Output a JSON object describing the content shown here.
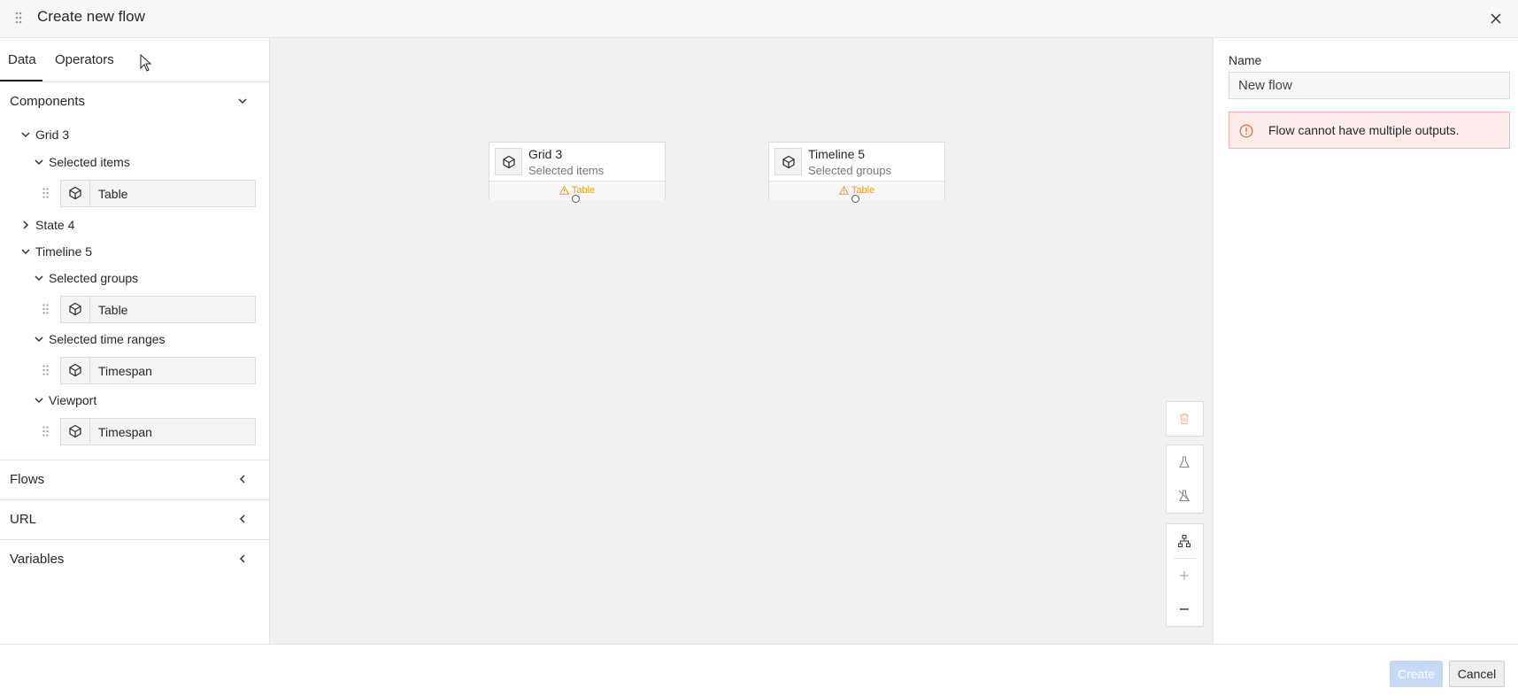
{
  "window": {
    "title": "Create new flow"
  },
  "tabs": [
    {
      "label": "Data",
      "active": true
    },
    {
      "label": "Operators",
      "active": false
    }
  ],
  "components": {
    "label": "Components",
    "tree": {
      "grid3": {
        "label": "Grid 3",
        "selected_items": {
          "label": "Selected items",
          "leaf": "Table"
        }
      },
      "state4": {
        "label": "State 4"
      },
      "timeline5": {
        "label": "Timeline 5",
        "selected_groups": {
          "label": "Selected groups",
          "leaf": "Table"
        },
        "selected_time_ranges": {
          "label": "Selected time ranges",
          "leaf": "Timespan"
        },
        "viewport": {
          "label": "Viewport",
          "leaf": "Timespan"
        }
      }
    }
  },
  "sections": {
    "flows": "Flows",
    "url": "URL",
    "variables": "Variables"
  },
  "canvas": {
    "nodes": [
      {
        "title": "Grid 3",
        "subtitle": "Selected items",
        "port": "Table"
      },
      {
        "title": "Timeline 5",
        "subtitle": "Selected groups",
        "port": "Table"
      }
    ]
  },
  "properties": {
    "name_label": "Name",
    "name_value": "New flow",
    "error": "Flow cannot have multiple outputs."
  },
  "footer": {
    "create": "Create",
    "cancel": "Cancel"
  },
  "colors": {
    "warning": "#e8a317",
    "error_bg": "#fdecec",
    "error_icon": "#e8734a",
    "primary_disabled": "#c9d8f5"
  }
}
